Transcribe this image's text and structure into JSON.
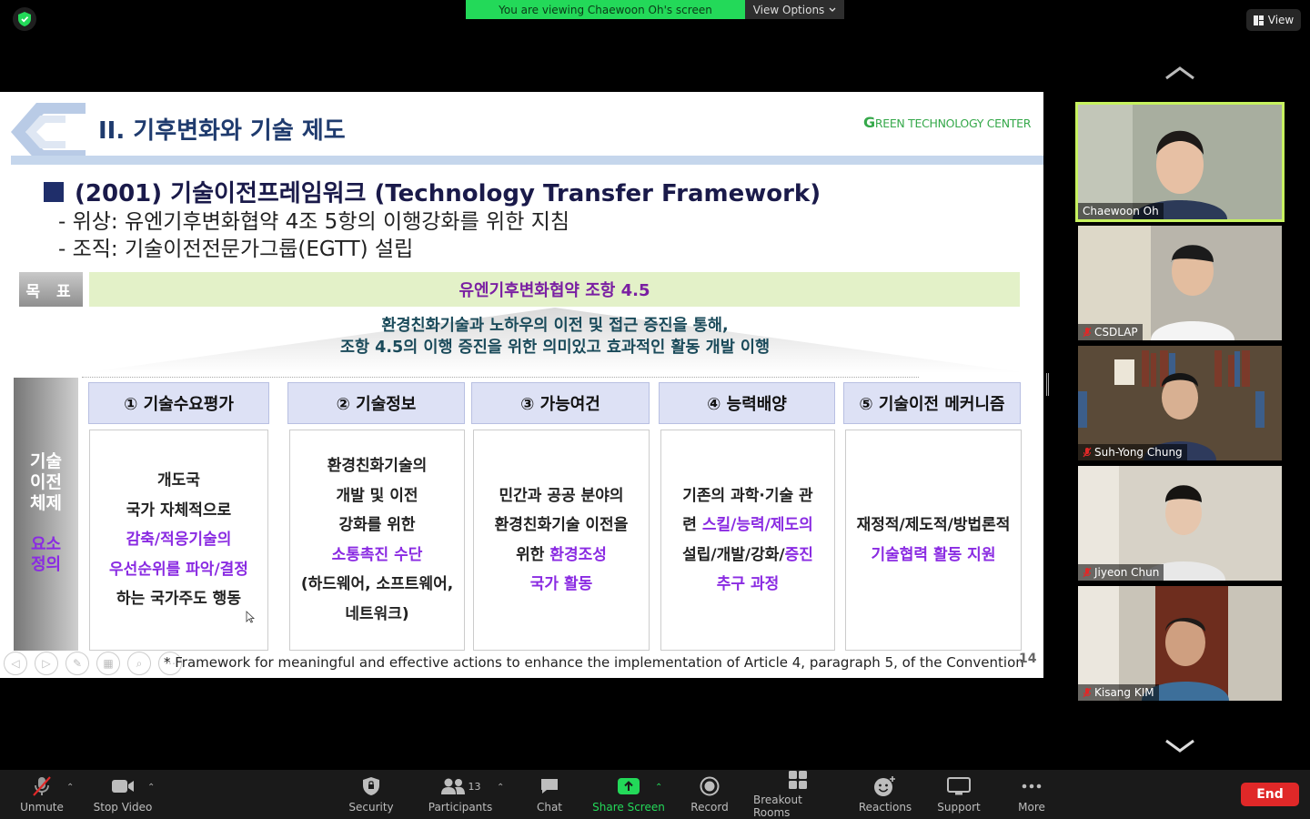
{
  "top": {
    "banner_text": "You are viewing Chaewoon Oh's screen",
    "view_options": "View Options",
    "view_button": "View"
  },
  "slide": {
    "title": "II. 기후변화와 기술 제도",
    "logo_initial": "G",
    "logo_rest": "REEN TECHNOLOGY CENTER",
    "heading": "(2001) 기술이전프레임워크 (Technology Transfer Framework)",
    "sub1": "- 위상: 유엔기후변화협약 4조 5항의 이행강화를 위한 지침",
    "sub2": "- 조직: 기술이전전문가그룹(EGTT) 설립",
    "goal_label": "목 표",
    "goal_bar": "유엔기후변화협약 조항 4.5",
    "arrow_line1": "환경친화기술과 노하우의 이전 및 접근 증진을 통해,",
    "arrow_line2": "조항 4.5의 이행 증진을 위한 의미있고 효과적인 활동 개발 이행",
    "side_top": [
      "기술",
      "이전",
      "체제"
    ],
    "side_bottom": [
      "요소",
      "정의"
    ],
    "columns": [
      {
        "head": "① 기술수요평가",
        "lines": [
          [
            "개도국"
          ],
          [
            "국가 자체적으로"
          ],
          [
            "|감축/적응기술의"
          ],
          [
            "|우선순위를 파악/결정"
          ],
          [
            "하는 국가주도 행동"
          ]
        ]
      },
      {
        "head": "② 기술정보",
        "lines": [
          [
            "환경친화기술의"
          ],
          [
            "개발 및 이전"
          ],
          [
            "강화를 위한"
          ],
          [
            "|소통촉진 수단"
          ],
          [
            "(하드웨어, 소프트웨어,"
          ],
          [
            "네트워크)"
          ]
        ]
      },
      {
        "head": "③ 가능여건",
        "lines": [
          [
            "민간과 공공 분야의"
          ],
          [
            "환경친화기술 이전을"
          ],
          [
            "위한 ",
            "|환경조성"
          ],
          [
            "|국가 활동"
          ]
        ]
      },
      {
        "head": "④ 능력배양",
        "lines": [
          [
            "기존의 과학·기술 관"
          ],
          [
            "련 ",
            "|스킬/능력/제도의"
          ],
          [
            "설립/개발/강화/",
            "|증진"
          ],
          [
            "|추구 과정"
          ]
        ]
      },
      {
        "head": "⑤ 기술이전 메커니즘",
        "lines": [
          [
            "재정적/제도적/방법론적"
          ],
          [
            "|기술협력 활동 지원"
          ]
        ]
      }
    ],
    "footnote": "* Framework for meaningful and effective actions to enhance the implementation of Article 4, paragraph 5, of the Convention",
    "page_number": "14"
  },
  "participants": [
    {
      "name": "Chaewoon Oh",
      "muted": false,
      "active": true
    },
    {
      "name": "CSDLAP",
      "muted": true,
      "active": false
    },
    {
      "name": "Suh-Yong Chung",
      "muted": true,
      "active": false
    },
    {
      "name": "Jiyeon Chun",
      "muted": true,
      "active": false
    },
    {
      "name": "Kisang KIM",
      "muted": true,
      "active": false
    }
  ],
  "toolbar": {
    "unmute": "Unmute",
    "stop_video": "Stop Video",
    "security": "Security",
    "participants": "Participants",
    "participants_count": "13",
    "chat": "Chat",
    "share_screen": "Share Screen",
    "record": "Record",
    "breakout_rooms": "Breakout Rooms",
    "reactions": "Reactions",
    "support": "Support",
    "more": "More",
    "end": "End"
  },
  "colors": {
    "accent_green": "#23d959",
    "end_red": "#e02828",
    "slide_purple": "#8a2be2",
    "active_speaker": "#c7f25f"
  }
}
